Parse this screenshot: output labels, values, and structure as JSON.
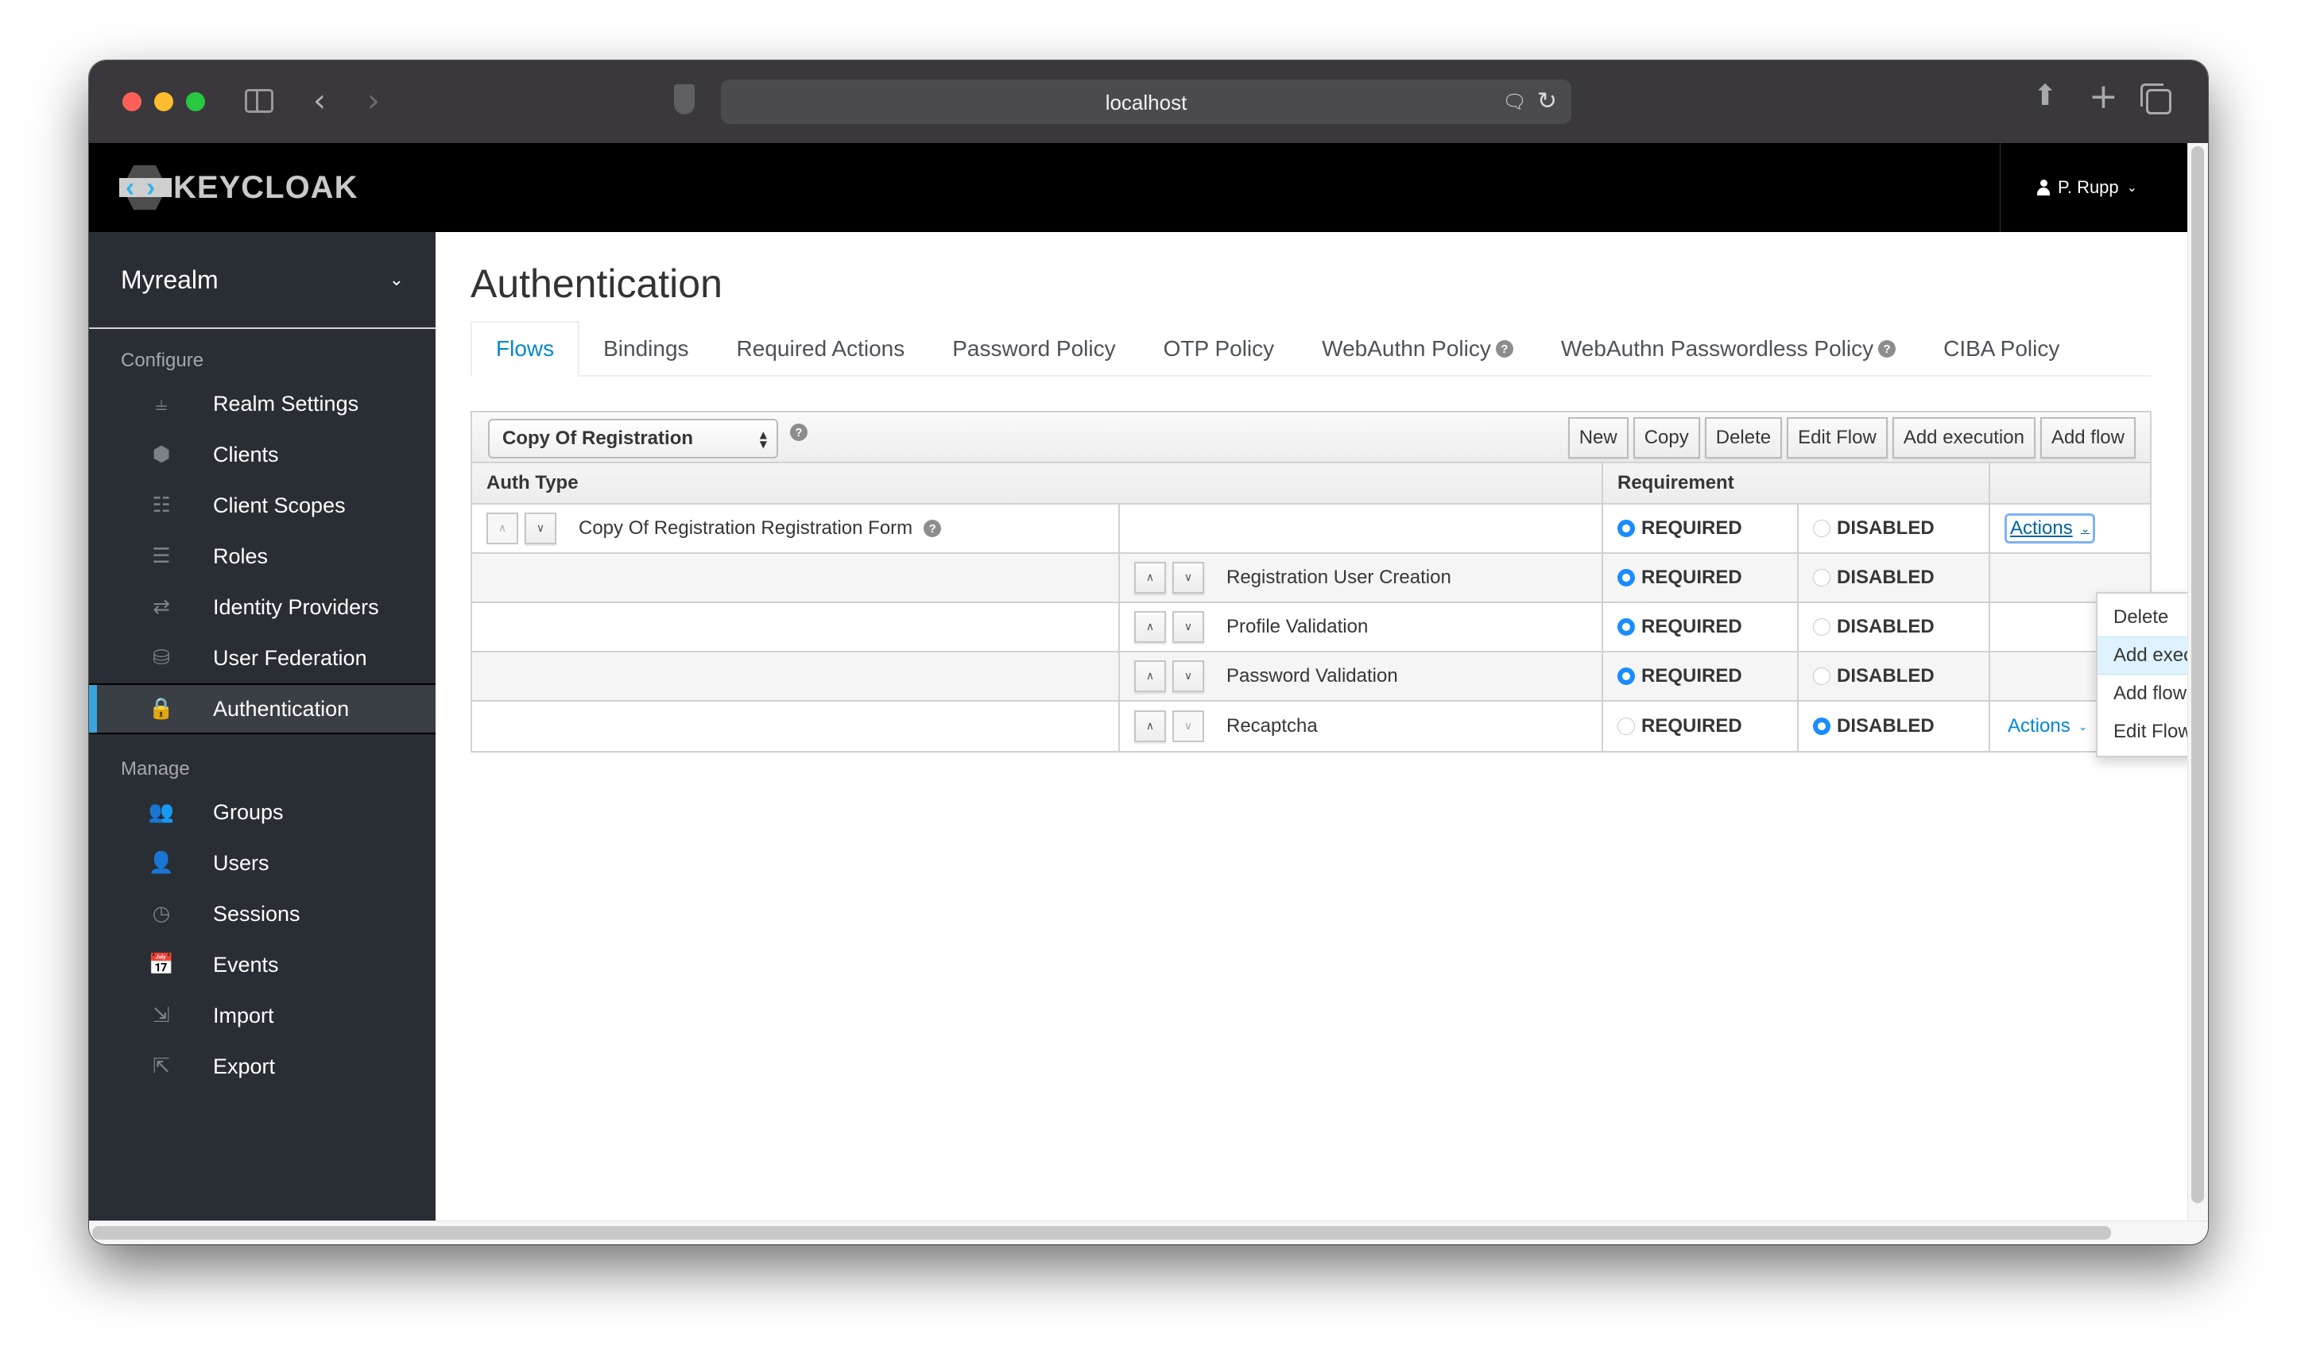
{
  "browser": {
    "url": "localhost",
    "icons": [
      "sidebar-toggle-icon",
      "back-icon",
      "forward-icon",
      "shield-icon",
      "translate-icon",
      "reload-icon",
      "share-icon",
      "new-tab-icon",
      "tabs-overview-icon"
    ]
  },
  "header": {
    "logo_text": "KEYCLOAK",
    "user_name": "P. Rupp"
  },
  "sidebar": {
    "realm": "Myrealm",
    "sections": [
      {
        "title": "Configure",
        "items": [
          {
            "label": "Realm Settings",
            "icon": "sliders-icon"
          },
          {
            "label": "Clients",
            "icon": "cube-icon"
          },
          {
            "label": "Client Scopes",
            "icon": "cubes-icon"
          },
          {
            "label": "Roles",
            "icon": "list-icon"
          },
          {
            "label": "Identity Providers",
            "icon": "exchange-icon"
          },
          {
            "label": "User Federation",
            "icon": "database-icon"
          },
          {
            "label": "Authentication",
            "icon": "lock-icon",
            "active": true
          }
        ]
      },
      {
        "title": "Manage",
        "items": [
          {
            "label": "Groups",
            "icon": "users-icon"
          },
          {
            "label": "Users",
            "icon": "user-icon"
          },
          {
            "label": "Sessions",
            "icon": "clock-icon"
          },
          {
            "label": "Events",
            "icon": "calendar-icon"
          },
          {
            "label": "Import",
            "icon": "import-icon"
          },
          {
            "label": "Export",
            "icon": "export-icon"
          }
        ]
      }
    ]
  },
  "main": {
    "title": "Authentication",
    "tabs": [
      {
        "label": "Flows",
        "active": true
      },
      {
        "label": "Bindings"
      },
      {
        "label": "Required Actions"
      },
      {
        "label": "Password Policy"
      },
      {
        "label": "OTP Policy"
      },
      {
        "label": "WebAuthn Policy",
        "help": true
      },
      {
        "label": "WebAuthn Passwordless Policy",
        "help": true
      },
      {
        "label": "CIBA Policy"
      }
    ],
    "flow_select": "Copy Of Registration",
    "toolbar_buttons": [
      "New",
      "Copy",
      "Delete",
      "Edit Flow",
      "Add execution",
      "Add flow"
    ],
    "table": {
      "headers": {
        "auth_type": "Auth Type",
        "requirement": "Requirement",
        "actions": ""
      },
      "requirement_options": [
        "REQUIRED",
        "DISABLED"
      ],
      "rows": [
        {
          "level": 0,
          "name": "Copy Of Registration Registration Form",
          "help": true,
          "requirement": "REQUIRED",
          "actions": "Actions",
          "up_enabled": false,
          "down_enabled": true,
          "menu_open": true
        },
        {
          "level": 1,
          "name": "Registration User Creation",
          "requirement": "REQUIRED",
          "actions": "",
          "up_enabled": true,
          "down_enabled": true
        },
        {
          "level": 1,
          "name": "Profile Validation",
          "requirement": "REQUIRED",
          "actions": "",
          "up_enabled": true,
          "down_enabled": true
        },
        {
          "level": 1,
          "name": "Password Validation",
          "requirement": "REQUIRED",
          "actions": "",
          "up_enabled": true,
          "down_enabled": true
        },
        {
          "level": 1,
          "name": "Recaptcha",
          "requirement": "DISABLED",
          "actions": "Actions",
          "up_enabled": true,
          "down_enabled": false
        }
      ]
    },
    "actions_menu": {
      "items": [
        "Delete",
        "Add execution",
        "Add flow",
        "Edit Flow"
      ],
      "highlighted": "Add execution"
    }
  },
  "colors": {
    "accent": "#0088ce",
    "radio_selected": "#1a8cff",
    "sidebar_bg": "#292e34",
    "active_indicator": "#39a5dc",
    "header_bg": "#000000"
  }
}
